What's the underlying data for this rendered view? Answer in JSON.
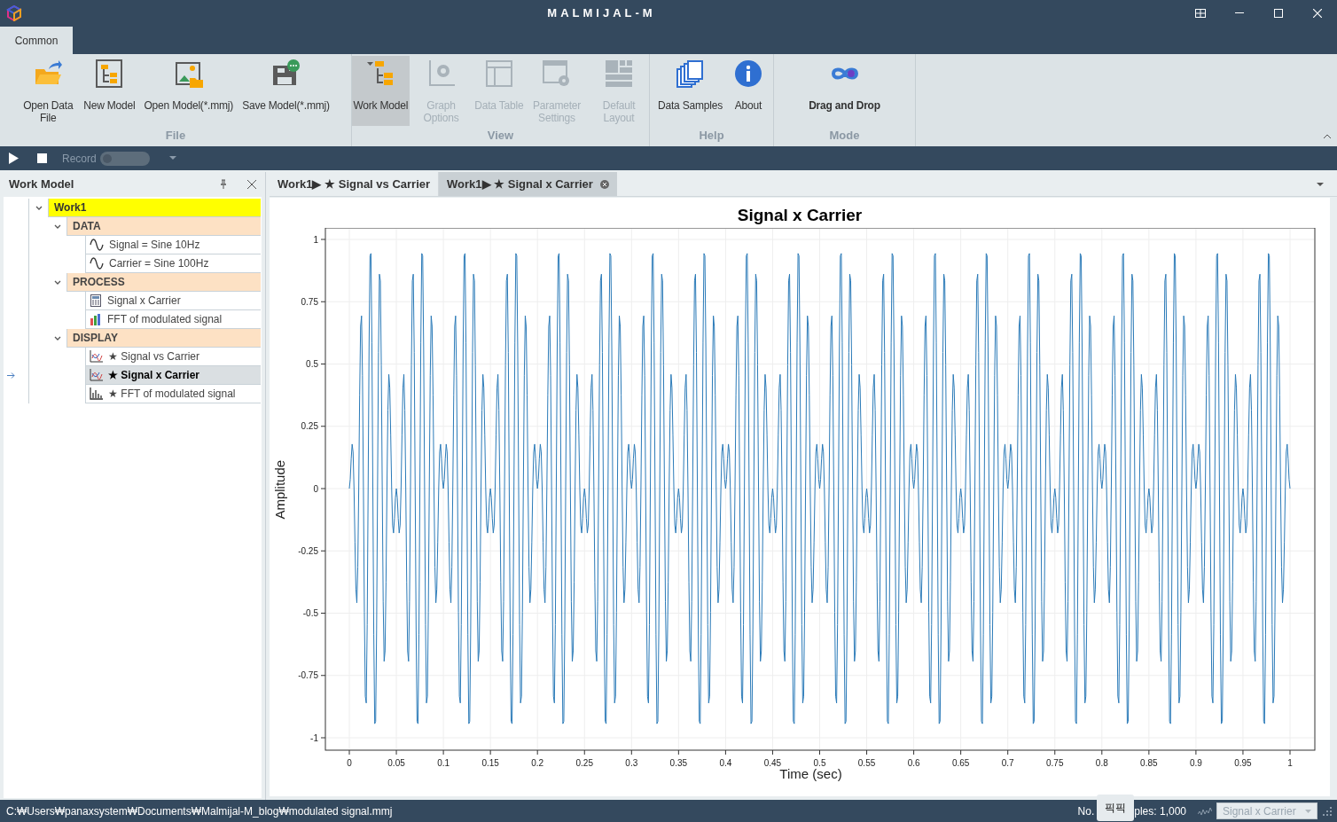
{
  "window": {
    "title": "MALMIJAL-M"
  },
  "ribbon": {
    "tabs": [
      {
        "label": "Common",
        "selected": true
      }
    ],
    "groups": [
      {
        "label": "File",
        "buttons": [
          {
            "label": "Open Data File",
            "kind": "open-data",
            "disabled": false,
            "selected": false
          },
          {
            "label": "New Model",
            "kind": "new-model",
            "disabled": false,
            "selected": false
          },
          {
            "label": "Open Model(*.mmj)",
            "kind": "open-model",
            "disabled": false,
            "selected": false
          },
          {
            "label": "Save Model(*.mmj)",
            "kind": "save-model",
            "disabled": false,
            "selected": false
          }
        ]
      },
      {
        "label": "View",
        "buttons": [
          {
            "label": "Work Model",
            "kind": "work-model",
            "disabled": false,
            "selected": true
          },
          {
            "label": "Graph Options",
            "kind": "graph-options",
            "disabled": true,
            "selected": false
          },
          {
            "label": "Data Table",
            "kind": "data-table",
            "disabled": true,
            "selected": false
          },
          {
            "label": "Parameter Settings",
            "kind": "parameter-settings",
            "disabled": true,
            "selected": false
          },
          {
            "label": "Default Layout",
            "kind": "default-layout",
            "disabled": true,
            "selected": false
          }
        ]
      },
      {
        "label": "Help",
        "buttons": [
          {
            "label": "Data Samples",
            "kind": "data-samples",
            "disabled": false,
            "selected": false
          },
          {
            "label": "About",
            "kind": "about",
            "disabled": false,
            "selected": false
          }
        ]
      },
      {
        "label": "Mode",
        "buttons": [
          {
            "label": "Drag and Drop",
            "kind": "drag-drop",
            "disabled": false,
            "selected": false
          }
        ]
      }
    ]
  },
  "playbar": {
    "record_label": "Record",
    "record_on": false
  },
  "work_model": {
    "title": "Work Model",
    "tree": [
      {
        "label": "Work1",
        "kind": "root",
        "expanded": true,
        "selected": false,
        "children": [
          {
            "label": "DATA",
            "kind": "group",
            "expanded": true,
            "selected": false,
            "children": [
              {
                "label": "Signal = Sine 10Hz",
                "kind": "sine",
                "selected": false
              },
              {
                "label": "Carrier = Sine 100Hz",
                "kind": "sine",
                "selected": false
              }
            ]
          },
          {
            "label": "PROCESS",
            "kind": "group",
            "expanded": true,
            "selected": false,
            "children": [
              {
                "label": "Signal x Carrier",
                "kind": "calc",
                "selected": false
              },
              {
                "label": "FFT of modulated signal",
                "kind": "fft",
                "selected": false
              }
            ]
          },
          {
            "label": "DISPLAY",
            "kind": "group",
            "expanded": true,
            "selected": false,
            "children": [
              {
                "label": "★ Signal vs Carrier",
                "kind": "plot",
                "selected": false
              },
              {
                "label": "★ Signal x Carrier",
                "kind": "plot",
                "selected": true
              },
              {
                "label": "★ FFT of modulated signal",
                "kind": "bars",
                "selected": false
              }
            ]
          }
        ]
      }
    ]
  },
  "doc_tabs": [
    {
      "label": "Work1▶ ★ Signal vs Carrier",
      "selected": false
    },
    {
      "label": "Work1▶ ★ Signal x Carrier",
      "selected": true
    }
  ],
  "chart": {
    "title": "Signal x Carrier",
    "xlabel": "Time (sec)",
    "ylabel": "Amplitude",
    "xticks": [
      "0",
      "0.05",
      "0.1",
      "0.15",
      "0.2",
      "0.25",
      "0.3",
      "0.35",
      "0.4",
      "0.45",
      "0.5",
      "0.55",
      "0.6",
      "0.65",
      "0.7",
      "0.75",
      "0.8",
      "0.85",
      "0.9",
      "0.95",
      "1"
    ],
    "yticks": [
      "1",
      "0.75",
      "0.5",
      "0.25",
      "0",
      "-0.25",
      "-0.5",
      "-0.75",
      "-1"
    ]
  },
  "status_bar": {
    "path": "C:₩Users₩panaxsystem₩Documents₩Malmijal-M_blog₩modulated signal.mmj",
    "count_prefix": "No.",
    "tooltip": "픽픽",
    "count_suffix": "ples: 1,000",
    "display_select": "Signal x Carrier"
  }
}
